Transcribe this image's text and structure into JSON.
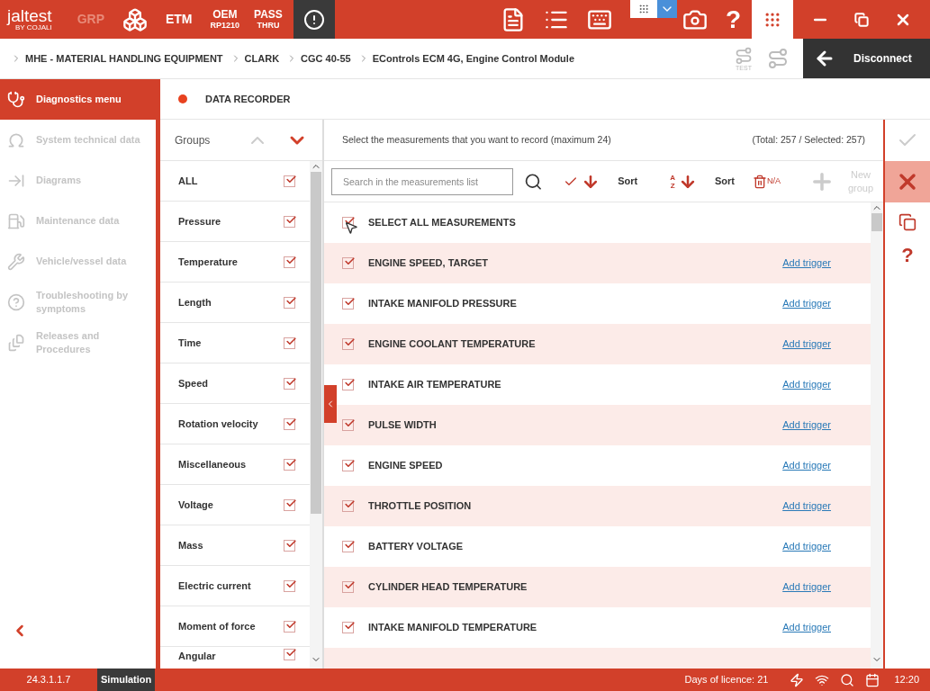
{
  "top_bar": {
    "logo": "jaltest",
    "logo_sub": "BY COJALI",
    "tools": [
      {
        "kind": "text",
        "label": "GRP",
        "disabled": true
      },
      {
        "kind": "cubes"
      },
      {
        "kind": "text",
        "label": "ETM",
        "disabled": false
      },
      {
        "kind": "stack",
        "label": "OEM",
        "sub": "RP1210"
      },
      {
        "kind": "stack",
        "label": "PASS",
        "sub": "THRU"
      },
      {
        "kind": "alert"
      }
    ]
  },
  "breadcrumb": [
    "MHE - MATERIAL HANDLING EQUIPMENT",
    "CLARK",
    "CGC 40-55",
    "EControls ECM 4G, Engine Control Module"
  ],
  "help_label": "?",
  "right_help_label": "?",
  "disconnect": "Disconnect",
  "test_label": "TEST",
  "sidebar": {
    "items": [
      {
        "label": "Diagnostics menu",
        "selected": true,
        "disabled": false
      },
      {
        "label": "System technical data",
        "selected": false,
        "disabled": true
      },
      {
        "label": "Diagrams",
        "selected": false,
        "disabled": true
      },
      {
        "label": "Maintenance data",
        "selected": false,
        "disabled": true
      },
      {
        "label": "Vehicle/vessel data",
        "selected": false,
        "disabled": true
      },
      {
        "label": "Troubleshooting by symptoms",
        "selected": false,
        "disabled": true
      },
      {
        "label": "Releases and Procedures",
        "selected": false,
        "disabled": true
      }
    ]
  },
  "section_title": "DATA RECORDER",
  "groups": {
    "title": "Groups",
    "items": [
      {
        "label": "ALL",
        "checked": true
      },
      {
        "label": "Pressure",
        "checked": true
      },
      {
        "label": "Temperature",
        "checked": true
      },
      {
        "label": "Length",
        "checked": true
      },
      {
        "label": "Time",
        "checked": true
      },
      {
        "label": "Speed",
        "checked": true
      },
      {
        "label": "Rotation velocity",
        "checked": true
      },
      {
        "label": "Miscellaneous",
        "checked": true
      },
      {
        "label": "Voltage",
        "checked": true
      },
      {
        "label": "Mass",
        "checked": true
      },
      {
        "label": "Electric current",
        "checked": true
      },
      {
        "label": "Moment of force",
        "checked": true
      },
      {
        "label": "Angular",
        "checked": true
      }
    ]
  },
  "instructions": "Select the measurements that you want to record (maximum 24)",
  "totals": "(Total: 257 / Selected: 257)",
  "search": {
    "placeholder": "Search in the measurements list"
  },
  "toolbar": {
    "sort_checked": "Sort",
    "sort_alpha": "Sort",
    "alpha_a": "A",
    "alpha_z": "Z",
    "na": "N/A",
    "new_group": "New group"
  },
  "select_all": {
    "label": "SELECT ALL MEASUREMENTS",
    "checked": true
  },
  "measurements": [
    {
      "name": "ENGINE SPEED, TARGET",
      "checked": true,
      "trigger": "Add trigger"
    },
    {
      "name": "INTAKE MANIFOLD PRESSURE",
      "checked": true,
      "trigger": "Add trigger"
    },
    {
      "name": "ENGINE COOLANT TEMPERATURE",
      "checked": true,
      "trigger": "Add trigger"
    },
    {
      "name": "INTAKE AIR TEMPERATURE",
      "checked": true,
      "trigger": "Add trigger"
    },
    {
      "name": "PULSE WIDTH",
      "checked": true,
      "trigger": "Add trigger"
    },
    {
      "name": "ENGINE SPEED",
      "checked": true,
      "trigger": "Add trigger"
    },
    {
      "name": "THROTTLE POSITION",
      "checked": true,
      "trigger": "Add trigger"
    },
    {
      "name": "BATTERY VOLTAGE",
      "checked": true,
      "trigger": "Add trigger"
    },
    {
      "name": "CYLINDER HEAD TEMPERATURE",
      "checked": true,
      "trigger": "Add trigger"
    },
    {
      "name": "INTAKE MANIFOLD TEMPERATURE",
      "checked": true,
      "trigger": "Add trigger"
    }
  ],
  "status_bar": {
    "version": "24.3.1.1.7",
    "mode": "Simulation",
    "licence": "Days of licence: 21",
    "time": "12:20"
  }
}
